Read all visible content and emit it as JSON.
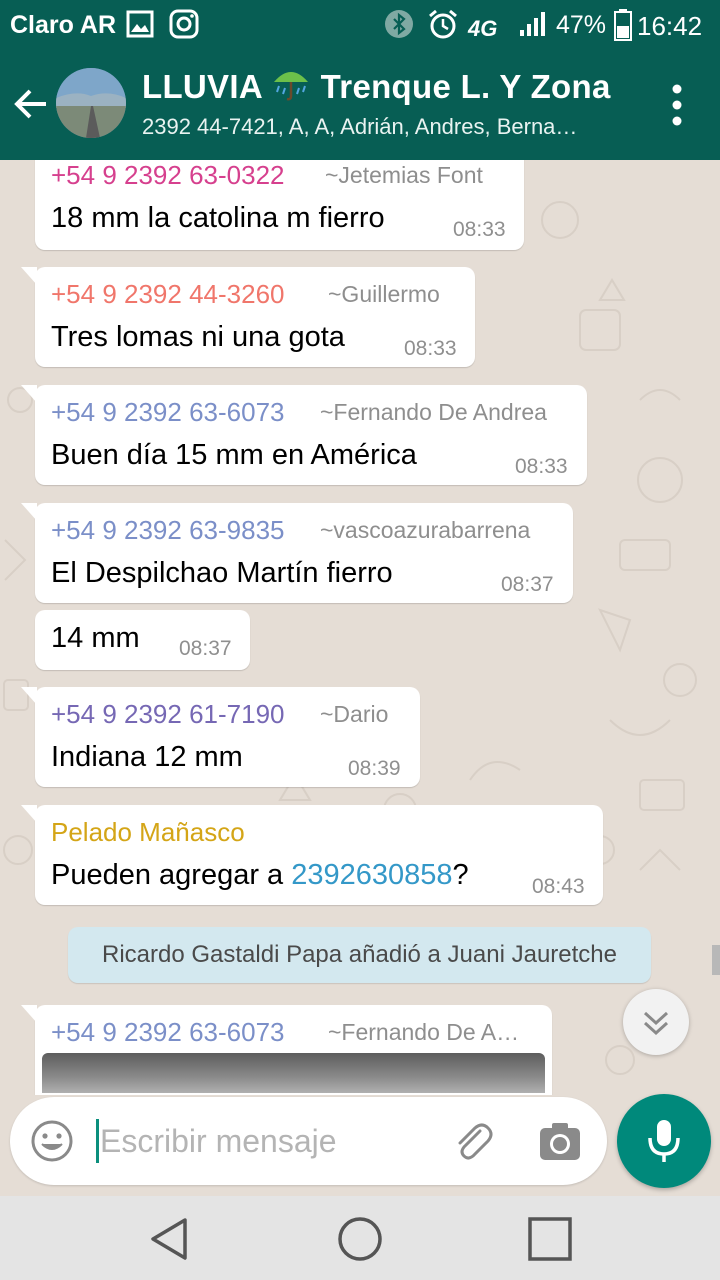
{
  "status_bar": {
    "carrier": "Claro AR",
    "network": "4G",
    "battery": "47%",
    "time": "16:42",
    "icons": [
      "image-icon",
      "instagram-icon",
      "bluetooth-icon",
      "alarm-icon",
      "4g-icon",
      "signal-icon",
      "battery-icon"
    ]
  },
  "header": {
    "title_part1": "LLUVIA",
    "title_emoji": "umbrella-rain-icon",
    "title_part2": "Trenque L. Y Zona",
    "subtitle": "2392 44-7421, A, A, Adrián, Andres, Berna…"
  },
  "messages": [
    {
      "sender": "+54 9 2392 63-0322",
      "alias": "~Jetemias Font",
      "text": "18 mm la catolina m fierro",
      "time": "08:33",
      "sender_color": "#d6408e"
    },
    {
      "sender": "+54 9 2392 44-3260",
      "alias": "~Guillermo",
      "text": "Tres lomas ni una gota",
      "time": "08:33",
      "sender_color": "#f0766b"
    },
    {
      "sender": "+54 9 2392 63-6073",
      "alias": "~Fernando De Andrea",
      "text": "Buen día 15 mm en América",
      "time": "08:33",
      "sender_color": "#7b8fc8"
    },
    {
      "sender": "+54 9 2392 63-9835",
      "alias": "~vascoazurabarrena",
      "text": "El Despilchao Martín fierro",
      "time": "08:37",
      "sender_color": "#7b8fc8"
    },
    {
      "text": "14 mm",
      "time": "08:37"
    },
    {
      "sender": "+54 9 2392 61-7190",
      "alias": "~Dario",
      "text": "Indiana 12 mm",
      "time": "08:39",
      "sender_color": "#7668b4"
    },
    {
      "sender": "Pelado Mañasco",
      "text_before": "Pueden agregar a ",
      "link": "2392630858",
      "text_after": "?",
      "time": "08:43",
      "sender_color": "#d4a517"
    },
    {
      "sender": "+54 9 2392 63-6073",
      "alias": "~Fernando De A…",
      "sender_color": "#7b8fc8"
    }
  ],
  "system_message": "Ricardo Gastaldi Papa añadió a Juani Jauretche",
  "input": {
    "placeholder": "Escribir mensaje"
  },
  "colors": {
    "header": "#075e54",
    "mic_button": "#00897b",
    "chat_background": "#e5ddd5",
    "system_bubble": "#d3e8ef"
  }
}
